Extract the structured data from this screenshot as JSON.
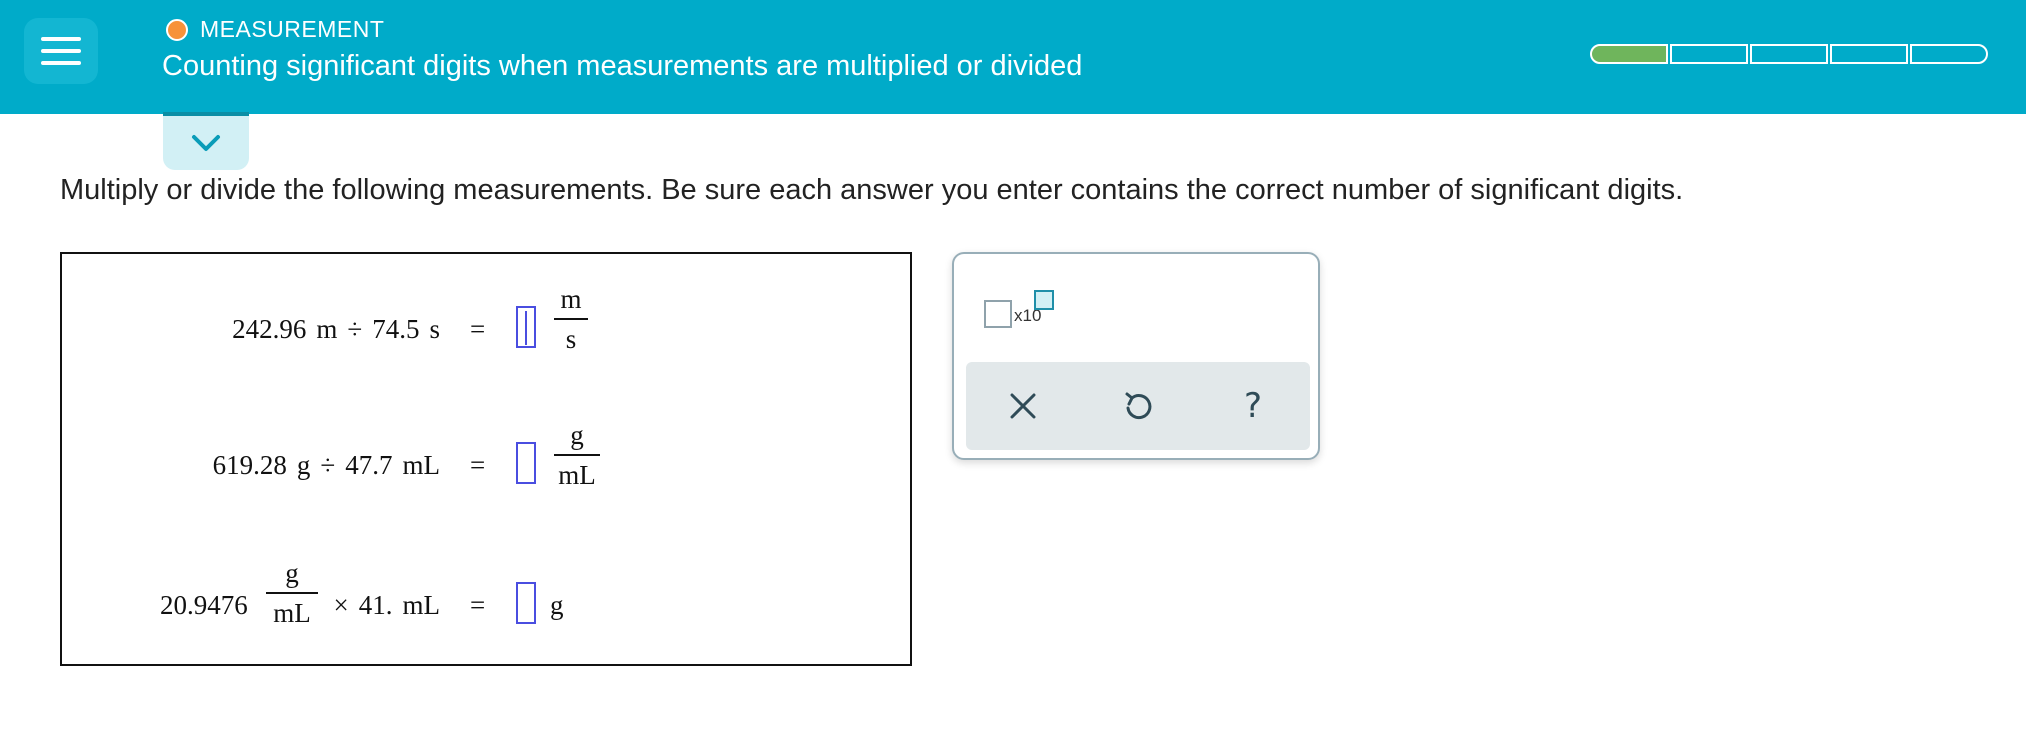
{
  "header": {
    "topic": "MEASUREMENT",
    "title": "Counting significant digits when measurements are multiplied or divided",
    "progress": {
      "segments": 5,
      "filled": 1
    }
  },
  "instructions": "Multiply or divide the following measurements. Be sure each answer you enter contains the correct number of significant digits.",
  "problems": [
    {
      "a": "242.96",
      "a_unit": "m",
      "op": "÷",
      "b": "74.5",
      "b_unit": "s",
      "eq": "=",
      "unit_num": "m",
      "unit_den": "s"
    },
    {
      "a": "619.28",
      "a_unit": "g",
      "op": "÷",
      "b": "47.7",
      "b_unit": "mL",
      "eq": "=",
      "unit_num": "g",
      "unit_den": "mL"
    },
    {
      "a": "20.9476",
      "a_unit_num": "g",
      "a_unit_den": "mL",
      "op": "×",
      "b": "41.",
      "b_unit": "mL",
      "eq": "=",
      "unit": "g"
    }
  ],
  "tools": {
    "sci_notation_label": "x10",
    "icons": [
      "close-icon",
      "undo-icon",
      "help-icon"
    ],
    "help_label": "?"
  },
  "colors": {
    "header": "#00abc9",
    "topic_dot": "#f7923a",
    "progress_fill": "#6fb55c",
    "answer_box": "#4a4ee0"
  }
}
